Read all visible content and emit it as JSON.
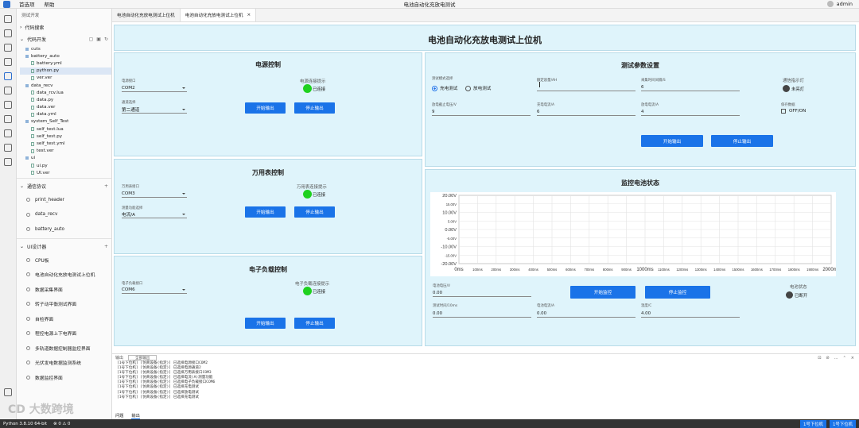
{
  "app": {
    "menu": [
      "首选项",
      "帮助"
    ],
    "window_title": "电池自动化充放电测试",
    "user": "admin"
  },
  "sidebar": {
    "header": "测试开发",
    "code_search": "代码搜索",
    "code_dev": "代码开发",
    "tree": [
      {
        "label": "cuts",
        "type": "folder",
        "indent": 1
      },
      {
        "label": "battery_auto",
        "type": "folder",
        "indent": 1
      },
      {
        "label": "battery.yml",
        "type": "file",
        "indent": 2
      },
      {
        "label": "python.py",
        "type": "file",
        "indent": 2,
        "selected": true
      },
      {
        "label": "ver.ver",
        "type": "file",
        "indent": 2
      },
      {
        "label": "data_recv",
        "type": "folder",
        "indent": 1
      },
      {
        "label": "data_rcv.lua",
        "type": "file",
        "indent": 2
      },
      {
        "label": "data.py",
        "type": "file",
        "indent": 2
      },
      {
        "label": "data.ver",
        "type": "file",
        "indent": 2
      },
      {
        "label": "data.yml",
        "type": "file",
        "indent": 2
      },
      {
        "label": "system_Self_Test",
        "type": "folder",
        "indent": 1
      },
      {
        "label": "self_test.lua",
        "type": "file",
        "indent": 2
      },
      {
        "label": "self_test.py",
        "type": "file",
        "indent": 2
      },
      {
        "label": "self_test.yml",
        "type": "file",
        "indent": 2
      },
      {
        "label": "test.ver",
        "type": "file",
        "indent": 2
      },
      {
        "label": "ui",
        "type": "folder",
        "indent": 1
      },
      {
        "label": "ui.py",
        "type": "file",
        "indent": 2
      },
      {
        "label": "UI.ver",
        "type": "file",
        "indent": 2
      }
    ],
    "protocol_section": "通信协议",
    "protocol_items": [
      "print_header",
      "data_recv",
      "battery_auto"
    ],
    "ui_section": "UI设计器",
    "ui_items": [
      "CPU板",
      "电池自动化充放电测试上位机",
      "数据采集界面",
      "转子动平衡测试界面",
      "自检界面",
      "程控电源上下电界面",
      "多轨道数据控制器监控界面",
      "光伏发电数据监测系统",
      "数据监控界面"
    ]
  },
  "tabs": [
    "电池自动化充放电测试上位机",
    "电池自动化充放电测试上位机"
  ],
  "main": {
    "title": "电池自动化充放电测试上位机",
    "power": {
      "title": "电源控制",
      "port_label": "电源接口",
      "port_value": "COM2",
      "channel_label": "通道选择",
      "channel_value": "第二通道",
      "conn_label": "电源连接提示",
      "conn_status": "已连接",
      "start": "开始输出",
      "stop": "停止输出"
    },
    "meter": {
      "title": "万用表控制",
      "port_label": "万用表接口",
      "port_value": "COM3",
      "mode_label": "测量功能选择",
      "mode_value": "电流/A",
      "conn_label": "万用表连接提示",
      "conn_status": "已连接",
      "start": "开始输出",
      "stop": "停止输出"
    },
    "load": {
      "title": "电子负载控制",
      "port_label": "电子负载接口",
      "port_value": "COM6",
      "conn_label": "电子负载连接提示",
      "conn_status": "已连接",
      "start": "开始输出",
      "stop": "停止输出"
    },
    "params": {
      "title": "测试参数设置",
      "mode_label": "测试模式选择",
      "mode_charge": "充电测试",
      "mode_discharge": "放电测试",
      "f1_label": "额定容量/AH",
      "f1_value": "",
      "f2_label": "采集时间间隔/S",
      "f2_value": "6",
      "comm_label": "通信指示灯",
      "comm_status": "未亮灯",
      "f3_label": "放电截止电压/V",
      "f3_value": "9",
      "f4_label": "充电电流/A",
      "f4_value": "6",
      "f5_label": "放电电流/A",
      "f5_value": "4",
      "save_label": "保存数据",
      "save_option": "OFF/ON",
      "start": "开始输出",
      "stop": "停止输出"
    },
    "monitor": {
      "title": "监控电池状态",
      "start": "开始监控",
      "stop": "停止监控",
      "r1_label": "电池电压/V",
      "r1_value": "0.00",
      "state_label": "电池状态",
      "state_value": "已断开",
      "r2_label": "测试时间/10ms",
      "r2_value": "0.00",
      "r3_label": "电池电流/A",
      "r3_value": "0.00",
      "r4_label": "温度/C",
      "r4_value": "4.00"
    }
  },
  "chart_data": {
    "type": "line",
    "title": "",
    "xlabel": "",
    "ylabel": "",
    "xlim": [
      0,
      2000
    ],
    "ylim": [
      -20,
      20
    ],
    "x_ticks": [
      "0ms",
      "100ms",
      "200ms",
      "300ms",
      "400ms",
      "500ms",
      "600ms",
      "700ms",
      "800ms",
      "900ms",
      "1000ms",
      "1100ms",
      "1200ms",
      "1300ms",
      "1400ms",
      "1500ms",
      "1600ms",
      "1700ms",
      "1800ms",
      "1900ms",
      "2000ms"
    ],
    "y_ticks": [
      "20.00V",
      "15.00V",
      "10.00V",
      "5.00V",
      "0.00V",
      "-5.00V",
      "-10.00V",
      "-15.00V",
      "-20.00V"
    ],
    "series": [],
    "grid": true
  },
  "output": {
    "tabs": [
      "问题",
      "输出"
    ],
    "filter_label": "输出",
    "filter_value": "全部输出",
    "lines": [
      "[1号下位机] [仿真设备(指定)]  已选择电源接口COM2",
      "[1号下位机] [仿真设备(指定)]  已选择电源通道2",
      "[1号下位机] [仿真设备(指定)]  已选择万用表接口COM3",
      "[1号下位机] [仿真设备(指定)]  已选择电流(A)测量功能",
      "[1号下位机] [仿真设备(指定)]  已选择电子负载接口COM6",
      "[1号下位机] [仿真设备(指定)]  已选择充电测试",
      "[1号下位机] [仿真设备(指定)]  已选择放电测试",
      "[1号下位机] [仿真设备(指定)]  已选择充电测试"
    ]
  },
  "statusbar": {
    "left": [
      "Python 3.8.10 64-bit",
      "⊗ 0  ⚠ 0"
    ],
    "right": [
      "1号下位机",
      "1号下位机"
    ]
  },
  "colors": {
    "accent": "#1a73e8",
    "panel": "#dff4fb",
    "led_on": "#1fd11f"
  }
}
